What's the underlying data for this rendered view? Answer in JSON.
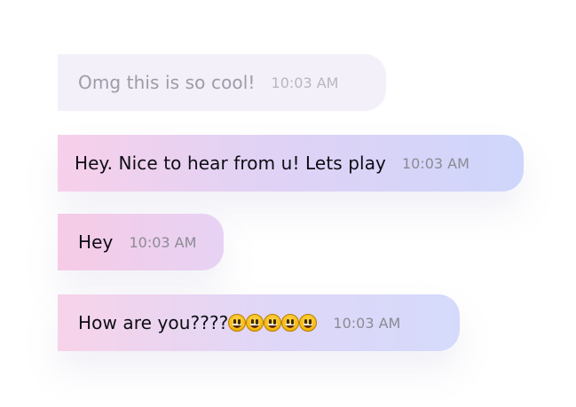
{
  "messages": [
    {
      "text": "Omg this is so cool!",
      "time": "10:03 AM",
      "faded": true
    },
    {
      "text": "Hey. Nice to hear from u! Lets play",
      "time": "10:03 AM"
    },
    {
      "text": "Hey",
      "time": "10:03 AM"
    },
    {
      "text": "How are you????",
      "emojis": [
        "grinning-face-emoji",
        "grinning-face-emoji",
        "grinning-face-emoji",
        "grinning-face-emoji",
        "grinning-face-emoji"
      ],
      "time": "10:03 AM"
    }
  ],
  "colors": {
    "text": "#0d0d14",
    "time": "#8b8b93",
    "faded_text": "#9d9ba6",
    "faded_bubble": "#f3f0fa",
    "gradient_pink": "#f7d0ea",
    "gradient_lavender": "#e0d2f5",
    "gradient_blue": "#cfd6fb"
  }
}
